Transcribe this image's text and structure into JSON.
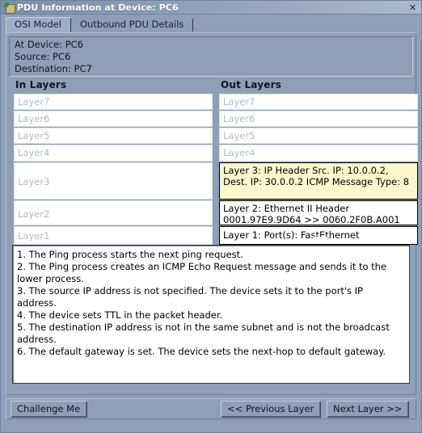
{
  "window": {
    "title": "PDU Information at Device: PC6",
    "icon": "packet-tracer-icon",
    "close_label": "✕"
  },
  "tabs": [
    {
      "label": "OSI Model",
      "selected": true
    },
    {
      "label": "Outbound PDU Details",
      "selected": false
    }
  ],
  "device_info": {
    "at_device": "At Device: PC6",
    "source": "Source: PC6",
    "destination": "Destination: PC7"
  },
  "in_layers": {
    "title": "In Layers",
    "items": [
      {
        "label": "Layer7",
        "state": "disabled",
        "size": "h20"
      },
      {
        "label": "Layer6",
        "state": "disabled",
        "size": "h20"
      },
      {
        "label": "Layer5",
        "state": "disabled",
        "size": "h20"
      },
      {
        "label": "Layer4",
        "state": "disabled",
        "size": "h21"
      },
      {
        "label": "Layer3",
        "state": "disabled",
        "size": "h45"
      },
      {
        "label": "Layer2",
        "state": "disabled",
        "size": "h31"
      },
      {
        "label": "Layer1",
        "state": "disabled",
        "size": "h23"
      }
    ]
  },
  "out_layers": {
    "title": "Out Layers",
    "items": [
      {
        "label": "Layer7",
        "state": "disabled",
        "size": "h20"
      },
      {
        "label": "Layer6",
        "state": "disabled",
        "size": "h20"
      },
      {
        "label": "Layer5",
        "state": "disabled",
        "size": "h20"
      },
      {
        "label": "Layer4",
        "state": "disabled",
        "size": "h21"
      },
      {
        "label": "Layer 3: IP Header Src. IP: 10.0.0.2, Dest. IP: 30.0.0.2 ICMP Message Type: 8",
        "state": "highlight",
        "size": "h45"
      },
      {
        "label": "Layer 2: Ethernet II Header\n0001.97E9.9D64 >> 0060.2F0B.A001",
        "state": "active",
        "size": "h31"
      },
      {
        "label": "Layer 1: Port(s): FastEthernet",
        "state": "active",
        "size": "h23"
      }
    ]
  },
  "arrow": {
    "name": "down-arrow-indicator"
  },
  "description": {
    "text": "1. The Ping process starts the next ping request.\n2. The Ping process creates an ICMP Echo Request message and sends it to the\n lower process.\n3. The source IP address is not specified. The device sets it to the port's IP address.\n4. The device sets TTL in the packet header.\n5. The destination IP address is not in the same subnet and is not the broadcast\n address.\n6. The default gateway is set. The device sets the next-hop to default gateway."
  },
  "buttons": {
    "challenge": "Challenge Me",
    "previous": "<< Previous Layer",
    "next": "Next Layer >>"
  },
  "colors": {
    "window_bg": "#8da0b8",
    "highlight_yellow": "#fbf8cd",
    "title_text": "#ffffff",
    "disabled_text": "#b6bbc2"
  }
}
